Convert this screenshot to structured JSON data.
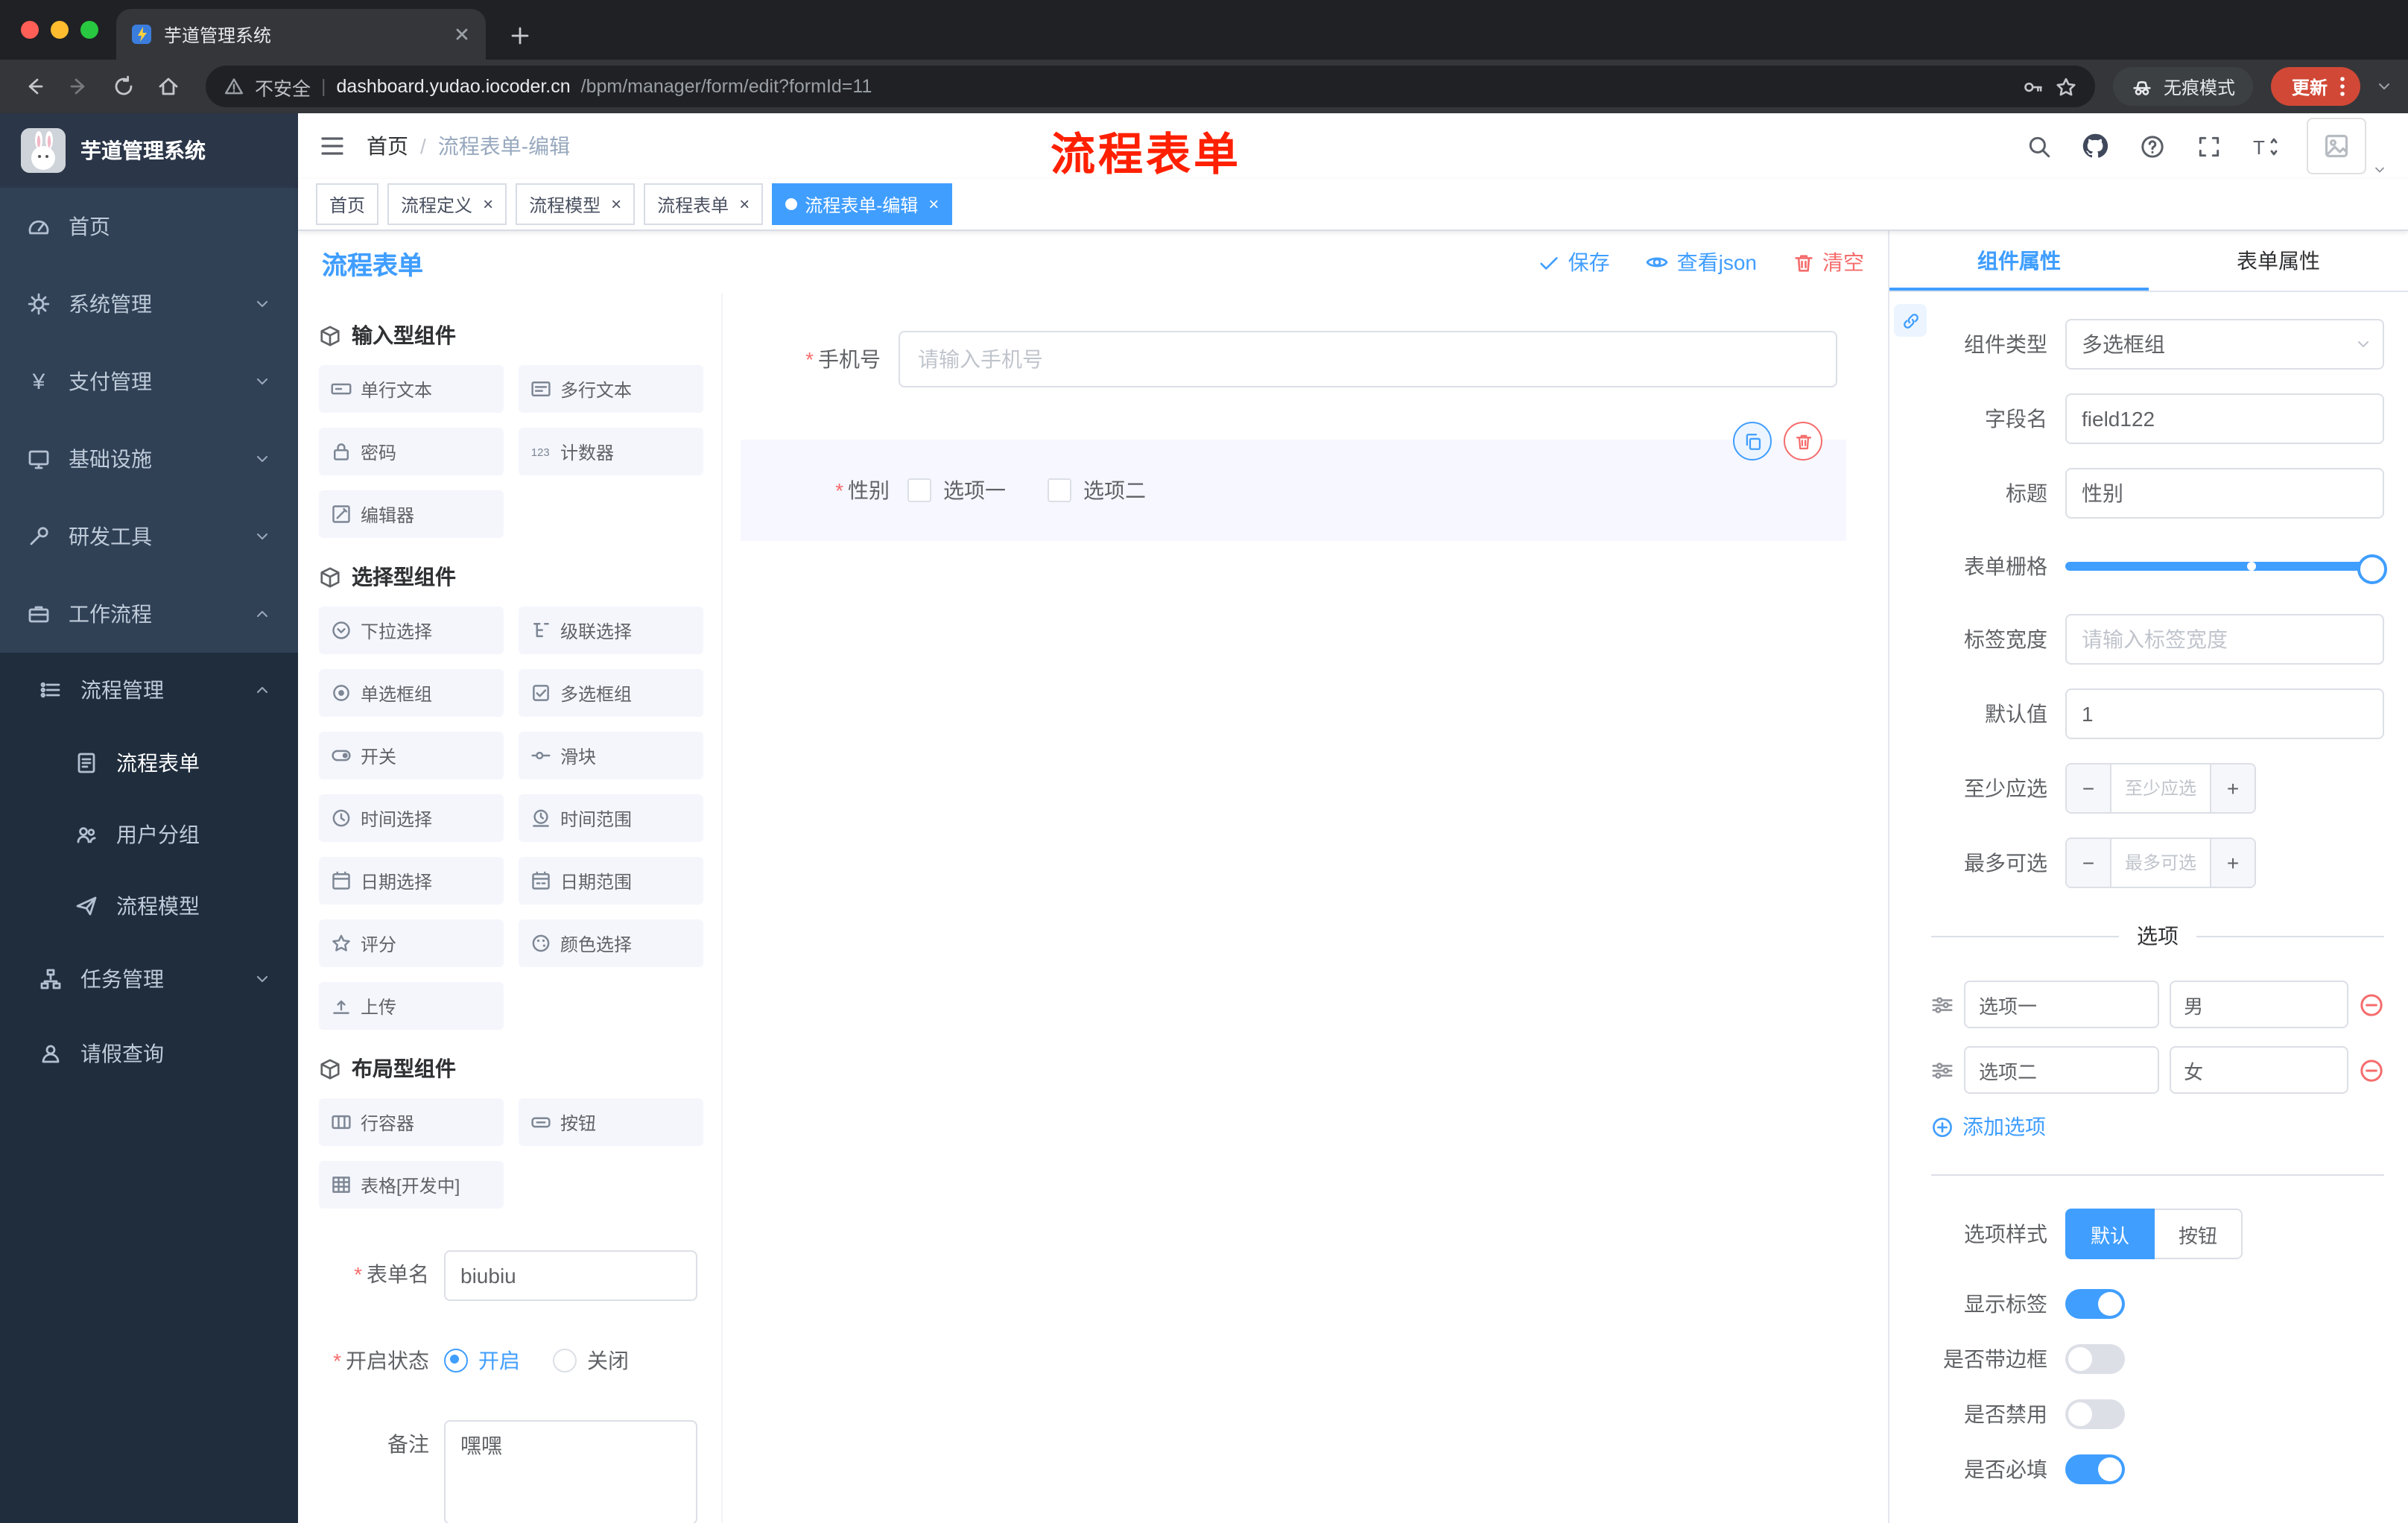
{
  "browser": {
    "tab_title": "芋道管理系统",
    "security_label": "不安全",
    "url_host": "dashboard.yudao.iocoder.cn",
    "url_path": "/bpm/manager/form/edit?formId=11",
    "incognito_label": "无痕模式",
    "update_label": "更新"
  },
  "sidebar": {
    "app_title": "芋道管理系统",
    "items": [
      {
        "icon": "dashboard-icon",
        "label": "首页"
      },
      {
        "icon": "gear-icon",
        "label": "系统管理"
      },
      {
        "icon": "yen-icon",
        "label": "支付管理"
      },
      {
        "icon": "monitor-icon",
        "label": "基础设施"
      },
      {
        "icon": "wrench-icon",
        "label": "研发工具"
      },
      {
        "icon": "briefcase-icon",
        "label": "工作流程"
      }
    ],
    "submenu": {
      "process_mgmt": "流程管理",
      "process_form": "流程表单",
      "user_group": "用户分组",
      "process_model": "流程模型",
      "task_mgmt": "任务管理",
      "leave_query": "请假查询"
    }
  },
  "navbar": {
    "breadcrumb": [
      "首页",
      "流程表单-编辑"
    ],
    "annotation": {
      "text": "流程表单",
      "color": "#ff2000"
    }
  },
  "tags": [
    {
      "label": "首页",
      "active": false,
      "closable": false
    },
    {
      "label": "流程定义",
      "active": false,
      "closable": true
    },
    {
      "label": "流程模型",
      "active": false,
      "closable": true
    },
    {
      "label": "流程表单",
      "active": false,
      "closable": true
    },
    {
      "label": "流程表单-编辑",
      "active": true,
      "closable": true
    }
  ],
  "designer": {
    "title": "流程表单",
    "actions": {
      "save": "保存",
      "view_json": "查看json",
      "clear": "清空"
    },
    "sections": [
      {
        "title": "输入型组件",
        "items": [
          {
            "icon": "input-icon",
            "label": "单行文本"
          },
          {
            "icon": "textarea-icon",
            "label": "多行文本"
          },
          {
            "icon": "password-icon",
            "label": "密码"
          },
          {
            "icon": "counter-icon",
            "label": "计数器"
          },
          {
            "icon": "editor-icon",
            "label": "编辑器"
          }
        ]
      },
      {
        "title": "选择型组件",
        "items": [
          {
            "icon": "select-icon",
            "label": "下拉选择"
          },
          {
            "icon": "cascader-icon",
            "label": "级联选择"
          },
          {
            "icon": "radio-icon",
            "label": "单选框组"
          },
          {
            "icon": "checkbox-icon",
            "label": "多选框组"
          },
          {
            "icon": "switch-icon",
            "label": "开关"
          },
          {
            "icon": "slider-icon",
            "label": "滑块"
          },
          {
            "icon": "time-icon",
            "label": "时间选择"
          },
          {
            "icon": "time-range-icon",
            "label": "时间范围"
          },
          {
            "icon": "date-icon",
            "label": "日期选择"
          },
          {
            "icon": "date-range-icon",
            "label": "日期范围"
          },
          {
            "icon": "rate-icon",
            "label": "评分"
          },
          {
            "icon": "color-icon",
            "label": "颜色选择"
          },
          {
            "icon": "upload-icon",
            "label": "上传"
          }
        ]
      },
      {
        "title": "布局型组件",
        "items": [
          {
            "icon": "row-icon",
            "label": "行容器"
          },
          {
            "icon": "button-icon",
            "label": "按钮"
          },
          {
            "icon": "table-icon",
            "label": "表格[开发中]"
          }
        ]
      }
    ],
    "form_meta": {
      "name_label": "表单名",
      "name_value": "biubiu",
      "status_label": "开启状态",
      "status_on": "开启",
      "status_off": "关闭",
      "remark_label": "备注",
      "remark_value": "嘿嘿"
    },
    "canvas": {
      "phone": {
        "label": "手机号",
        "placeholder": "请输入手机号"
      },
      "gender": {
        "label": "性别",
        "option1": "选项一",
        "option2": "选项二"
      }
    }
  },
  "props": {
    "tab_component": "组件属性",
    "tab_form": "表单属性",
    "component_type": {
      "label": "组件类型",
      "value": "多选框组"
    },
    "field_name": {
      "label": "字段名",
      "value": "field122"
    },
    "title": {
      "label": "标题",
      "value": "性别"
    },
    "grid": {
      "label": "表单栅格"
    },
    "label_width": {
      "label": "标签宽度",
      "placeholder": "请输入标签宽度"
    },
    "default_value": {
      "label": "默认值",
      "value": "1"
    },
    "min_select": {
      "label": "至少应选",
      "placeholder": "至少应选"
    },
    "max_select": {
      "label": "最多可选",
      "placeholder": "最多可选"
    },
    "options": {
      "divider": "选项",
      "rows": [
        {
          "name": "选项一",
          "value": "男"
        },
        {
          "name": "选项二",
          "value": "女"
        }
      ],
      "add": "添加选项"
    },
    "option_style": {
      "label": "选项样式",
      "default": "默认",
      "button": "按钮",
      "selected": "默认"
    },
    "show_label": {
      "label": "显示标签",
      "on": true
    },
    "border": {
      "label": "是否带边框",
      "on": false
    },
    "disabled": {
      "label": "是否禁用",
      "on": false
    },
    "required": {
      "label": "是否必填",
      "on": true
    }
  },
  "colors": {
    "accent": "#409eff",
    "danger": "#f56c6c",
    "annotation": "#ff2000",
    "sidebar": "#304156",
    "submenu": "#1f2d3d"
  }
}
